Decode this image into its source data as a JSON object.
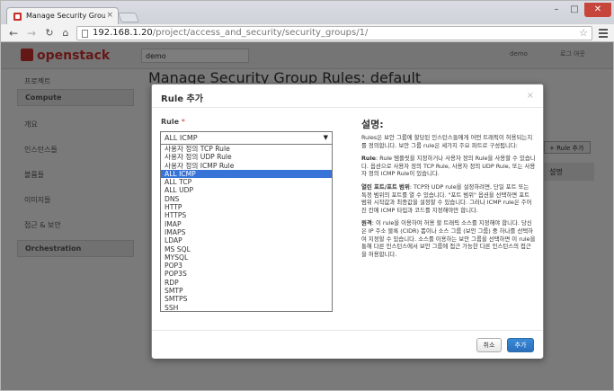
{
  "browser": {
    "tab_title": "Manage Security Group R",
    "tab_close": "×",
    "url_host": "192.168.1.20",
    "url_path": "/project/access_and_security/security_groups/1/",
    "window_min": "–",
    "window_max": "□",
    "window_close": "✕",
    "back_glyph": "←",
    "forward_glyph": "→",
    "reload_glyph": "↻",
    "home_glyph": "⌂",
    "star_glyph": "☆"
  },
  "page": {
    "logo_text": "openstack",
    "project_selector": "demo",
    "user_label": "demo",
    "logout_label": "로그 아웃",
    "heading": "Manage Security Group Rules: default",
    "sidebar": [
      {
        "label": "프로젝트",
        "header": false
      },
      {
        "label": "Compute",
        "header": true
      },
      {
        "label": "개요",
        "header": false
      },
      {
        "label": "인스턴스들",
        "header": false
      },
      {
        "label": "볼륨들",
        "header": false
      },
      {
        "label": "이미지들",
        "header": false
      },
      {
        "label": "접근 & 보안",
        "header": false
      },
      {
        "label": "Orchestration",
        "header": true
      }
    ],
    "add_rule_button": "+ Rule 추가",
    "table_header": "설명"
  },
  "modal": {
    "title": "Rule 추가",
    "close_glyph": "×",
    "rule_label": "Rule",
    "required_mark": "*",
    "selected_value": "ALL ICMP",
    "dropdown_arrow": "▼",
    "options": [
      "사용자 정의 TCP Rule",
      "사용자 정의 UDP Rule",
      "사용자 정의 ICMP Rule",
      "ALL ICMP",
      "ALL TCP",
      "ALL UDP",
      "DNS",
      "HTTP",
      "HTTPS",
      "IMAP",
      "IMAPS",
      "LDAP",
      "MS SQL",
      "MYSQL",
      "POP3",
      "POP3S",
      "RDP",
      "SMTP",
      "SMTPS",
      "SSH"
    ],
    "highlighted_option": "ALL ICMP",
    "help_title": "설명:",
    "help_paragraphs": [
      {
        "bold": "",
        "text": "Rules은 보안 그룹에 할당된 인스턴스들에게 어떤 트래픽이 허용되는지를 정의합니다. 보안 그룹 rule은 세가지 주요 파트로 구성됩니다:"
      },
      {
        "bold": "Rule",
        "text": ": Rule 템플릿을 지정하거나 사용자 정의 Rule을 사용할 수 있습니다. 옵션으로 사용자 정의 TCP Rule, 사용자 정의 UDP Rule, 또는 사용자 정의 ICMP Rule이 있습니다."
      },
      {
        "bold": "열린 포트/포트 범위",
        "text": ": TCP와 UDP rule을 설정하려면, 단일 포트 또는 특정 범위의 포트를 열 수 있습니다. \"포트 범위\" 옵션을 선택하면 포트 범위 시작값과 최종값을 설정할 수 있습니다. 그러나 ICMP rule은 주어진 칸에 ICMP 타입과 코드를 지정해야만 합니다."
      },
      {
        "bold": "원격",
        "text": ": 이 rule을 이용하여 허용 할 트래픽 소스를 지정해야 합니다. 당신은 IP 주소 블록 (CIDR) 폼이나 소스 그룹 (보안 그룹) 중 하나를 선택하여 지정할 수 있습니다. 소스를 이용하는 보안 그룹을 선택하면 이 rule을 통해 다른 인스턴스에서 보안 그룹에 접근 가능한 다른 인스턴스의 접근을 허용합니다."
      }
    ],
    "cancel_label": "취소",
    "submit_label": "추가"
  },
  "colors": {
    "brand_red": "#c9302c",
    "highlight_blue": "#3874d8",
    "primary_button": "#2a6fbe"
  }
}
